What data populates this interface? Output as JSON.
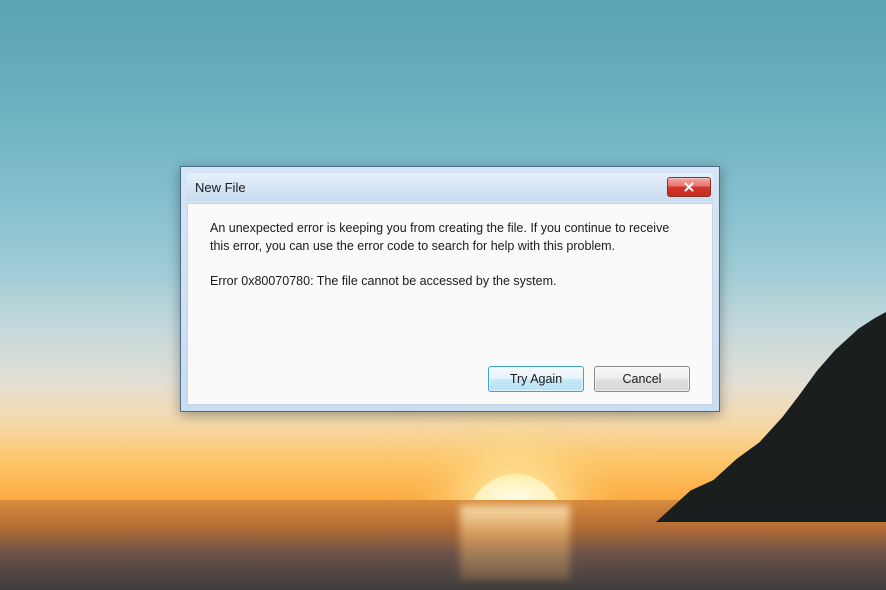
{
  "dialog": {
    "title": "New File",
    "message": "An unexpected error is keeping you from creating the file. If you continue to receive this error, you can use the error code to search for help with this problem.",
    "error_line": "Error 0x80070780: The file cannot be accessed by the system.",
    "buttons": {
      "try_again": "Try Again",
      "cancel": "Cancel"
    }
  }
}
